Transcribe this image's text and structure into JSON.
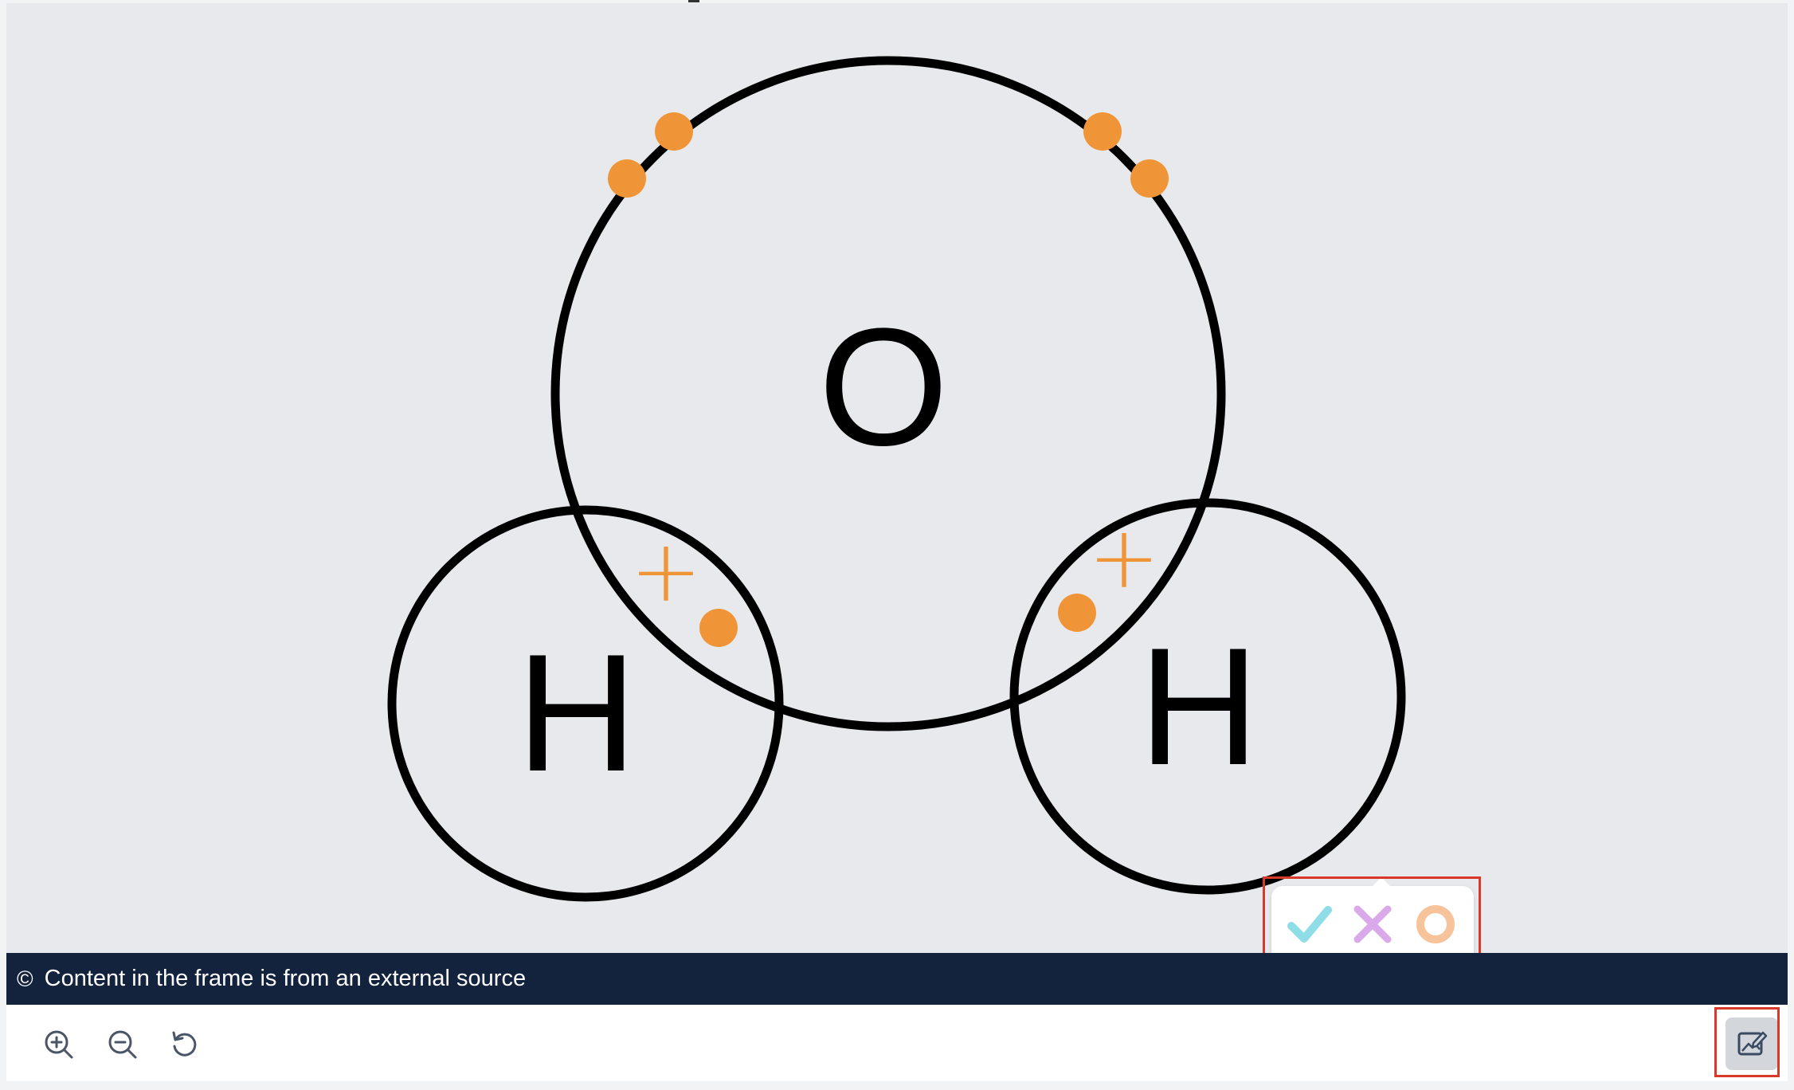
{
  "diagram": {
    "atom_center_label": "O",
    "atom_left_label": "H",
    "atom_right_label": "H",
    "proton_left_symbol": "+",
    "proton_right_symbol": "+",
    "line_color": "#000000",
    "electron_color": "#f09537"
  },
  "source_bar": {
    "icon": "copyright-icon",
    "copyright_symbol": "©",
    "text": "Content in the frame is from an external source",
    "background": "#13223d"
  },
  "toolbar": {
    "buttons": [
      {
        "name": "zoom-in",
        "icon": "zoom-in-icon"
      },
      {
        "name": "zoom-out",
        "icon": "zoom-out-icon"
      },
      {
        "name": "reset",
        "icon": "rotate-ccw-icon"
      }
    ],
    "annotate_icon": "image-edit-icon"
  },
  "mark_popup": {
    "options": [
      {
        "name": "correct",
        "icon": "check-icon",
        "color": "#8fdde6"
      },
      {
        "name": "incorrect",
        "icon": "cross-icon",
        "color": "#d9a9ea"
      },
      {
        "name": "circle",
        "icon": "circle-icon",
        "color": "#f6c39b"
      }
    ]
  },
  "highlight_color": "#d9392b"
}
